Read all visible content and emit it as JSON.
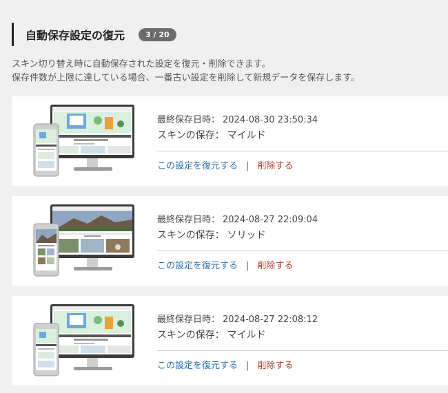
{
  "header": {
    "title": "自動保存設定の復元",
    "count": "3 / 20"
  },
  "description": {
    "line1": "スキン切り替え時に自動保存された設定を復元・削除できます。",
    "line2": "保存件数が上限に達している場合、一番古い設定を削除して新規データを保存します。"
  },
  "entries": [
    {
      "saved_label": "最終保存日時：",
      "saved_at": "2024-08-30 23:50:34",
      "skin_label": "スキンの保存：",
      "skin_name": "マイルド",
      "restore_label": "この設定を復元する",
      "separator": "|",
      "delete_label": "削除する",
      "thumbnail": "mild-skin-preview"
    },
    {
      "saved_label": "最終保存日時：",
      "saved_at": "2024-08-27 22:09:04",
      "skin_label": "スキンの保存：",
      "skin_name": "ソリッド",
      "restore_label": "この設定を復元する",
      "separator": "|",
      "delete_label": "削除する",
      "thumbnail": "solid-skin-preview"
    },
    {
      "saved_label": "最終保存日時：",
      "saved_at": "2024-08-27 22:08:12",
      "skin_label": "スキンの保存：",
      "skin_name": "マイルド",
      "restore_label": "この設定を復元する",
      "separator": "|",
      "delete_label": "削除する",
      "thumbnail": "mild-skin-preview"
    }
  ],
  "colors": {
    "restore_link": "#2a6fa8",
    "delete_link": "#b03a2e",
    "badge_bg": "#6b6b6b"
  }
}
